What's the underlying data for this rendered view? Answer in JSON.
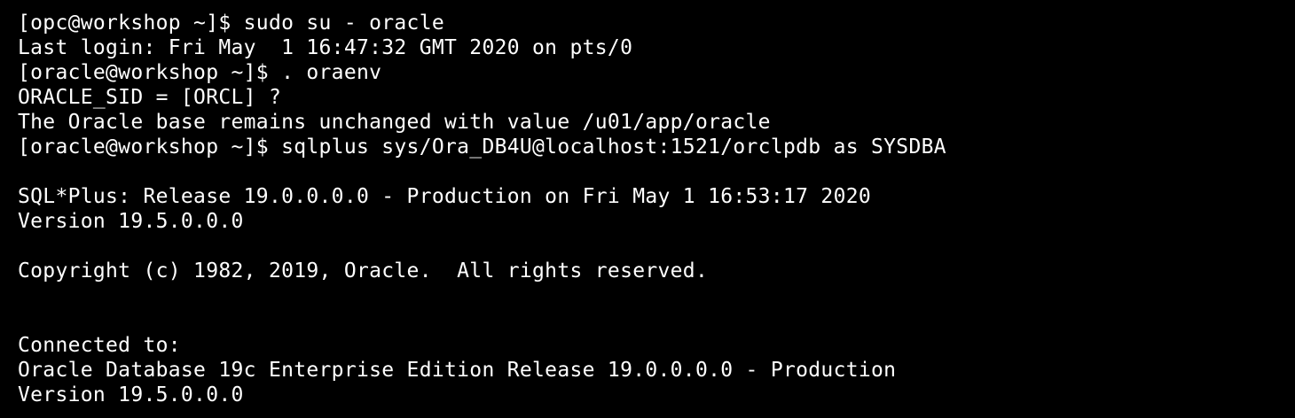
{
  "terminal": {
    "background_color": "#000000",
    "text_color": "#ffffff",
    "lines": [
      "[opc@workshop ~]$ sudo su - oracle",
      "Last login: Fri May  1 16:47:32 GMT 2020 on pts/0",
      "[oracle@workshop ~]$ . oraenv",
      "ORACLE_SID = [ORCL] ?",
      "The Oracle base remains unchanged with value /u01/app/oracle",
      "[oracle@workshop ~]$ sqlplus sys/Ora_DB4U@localhost:1521/orclpdb as SYSDBA",
      "",
      "SQL*Plus: Release 19.0.0.0.0 - Production on Fri May 1 16:53:17 2020",
      "Version 19.5.0.0.0",
      "",
      "Copyright (c) 1982, 2019, Oracle.  All rights reserved.",
      "",
      "",
      "Connected to:",
      "Oracle Database 19c Enterprise Edition Release 19.0.0.0.0 - Production",
      "Version 19.5.0.0.0"
    ]
  }
}
